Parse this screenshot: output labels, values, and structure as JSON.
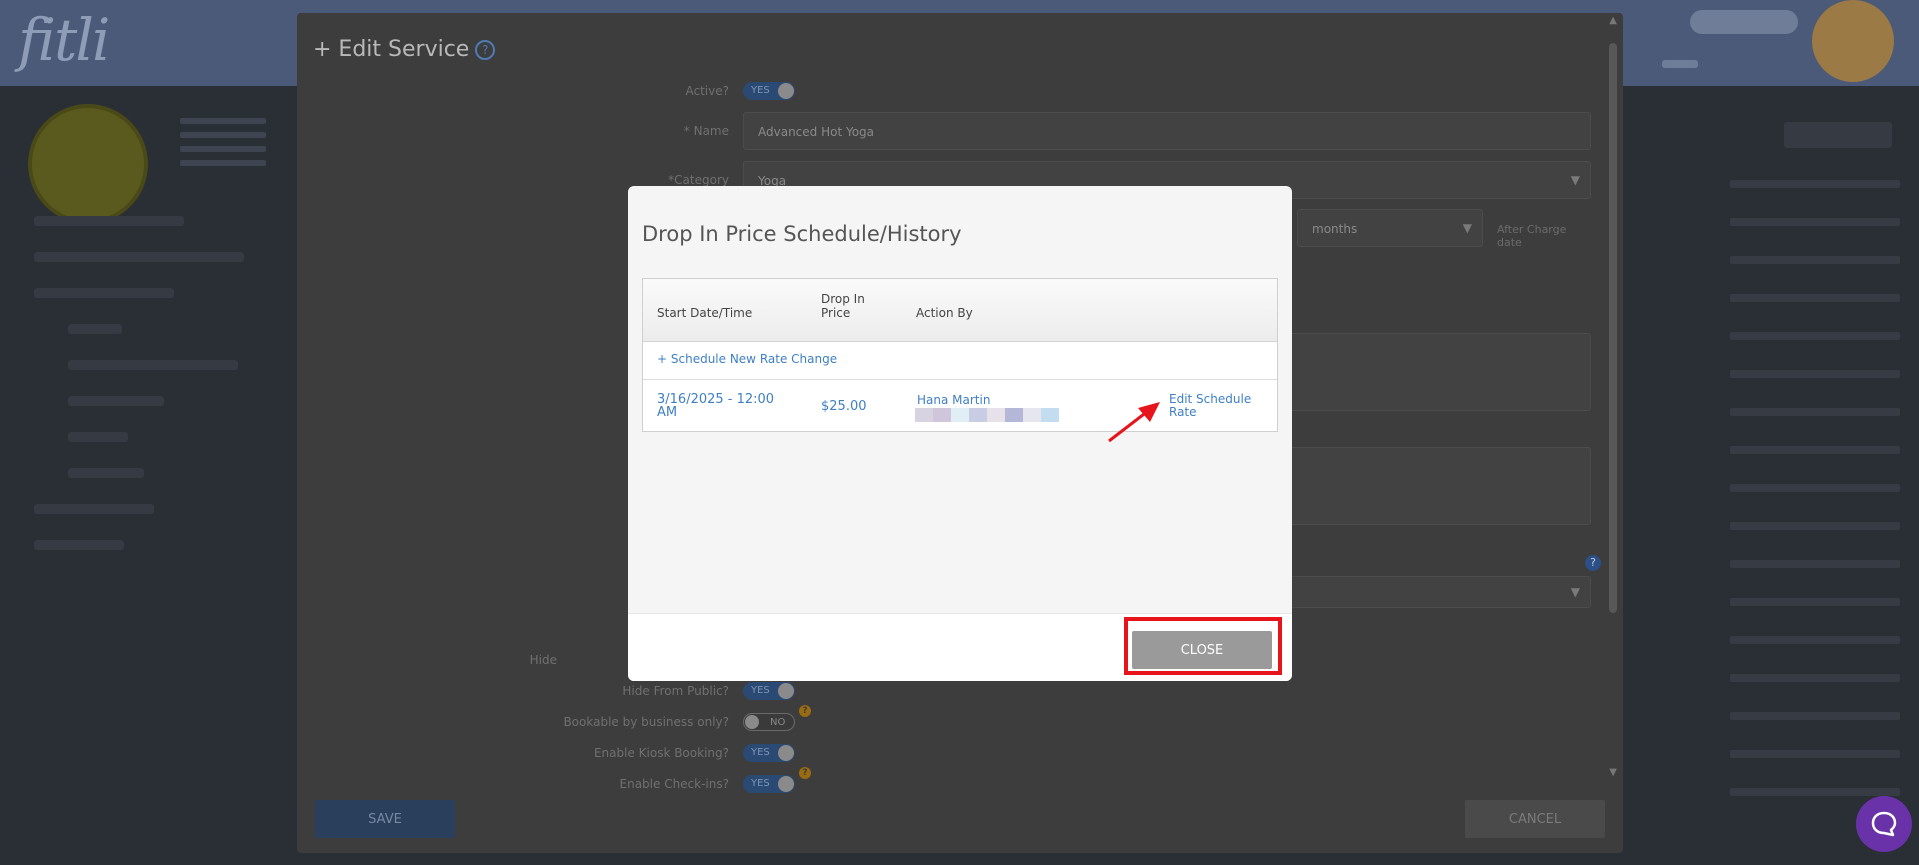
{
  "app": {
    "logo": "fitli"
  },
  "edit_service": {
    "title": "+ Edit Service",
    "help_glyph": "?",
    "fields": {
      "active_label": "Active?",
      "active_value": "YES",
      "name_label": "* Name",
      "name_value": "Advanced Hot Yoga",
      "category_label": "*Category",
      "category_value": "Yoga",
      "period_value": "months",
      "after_charge_label": "After Charge date",
      "hide_label": "Hide",
      "hide_public_label": "Hide From Public?",
      "hide_public_value": "YES",
      "bookable_label": "Bookable by business only?",
      "bookable_value": "NO",
      "kiosk_label": "Enable Kiosk Booking?",
      "kiosk_value": "YES",
      "checkins_label": "Enable Check-ins?",
      "checkins_value": "YES"
    },
    "save_label": "SAVE",
    "cancel_label": "CANCEL"
  },
  "modal": {
    "title": "Drop In Price Schedule/History",
    "columns": {
      "start": "Start Date/Time",
      "price": "Drop In Price",
      "action_by": "Action By"
    },
    "schedule_link": "+ Schedule New Rate Change",
    "rows": [
      {
        "start": "3/16/2025 - 12:00 AM",
        "price": "$25.00",
        "action_by": "Hana Martin",
        "edit_link": "Edit Schedule Rate"
      }
    ],
    "close_label": "CLOSE"
  },
  "colors": {
    "accent_link": "#3f7fc4",
    "annotation_red": "#e8141b",
    "close_button": "#9a9a9a",
    "chat_purple": "#6a32a8"
  }
}
